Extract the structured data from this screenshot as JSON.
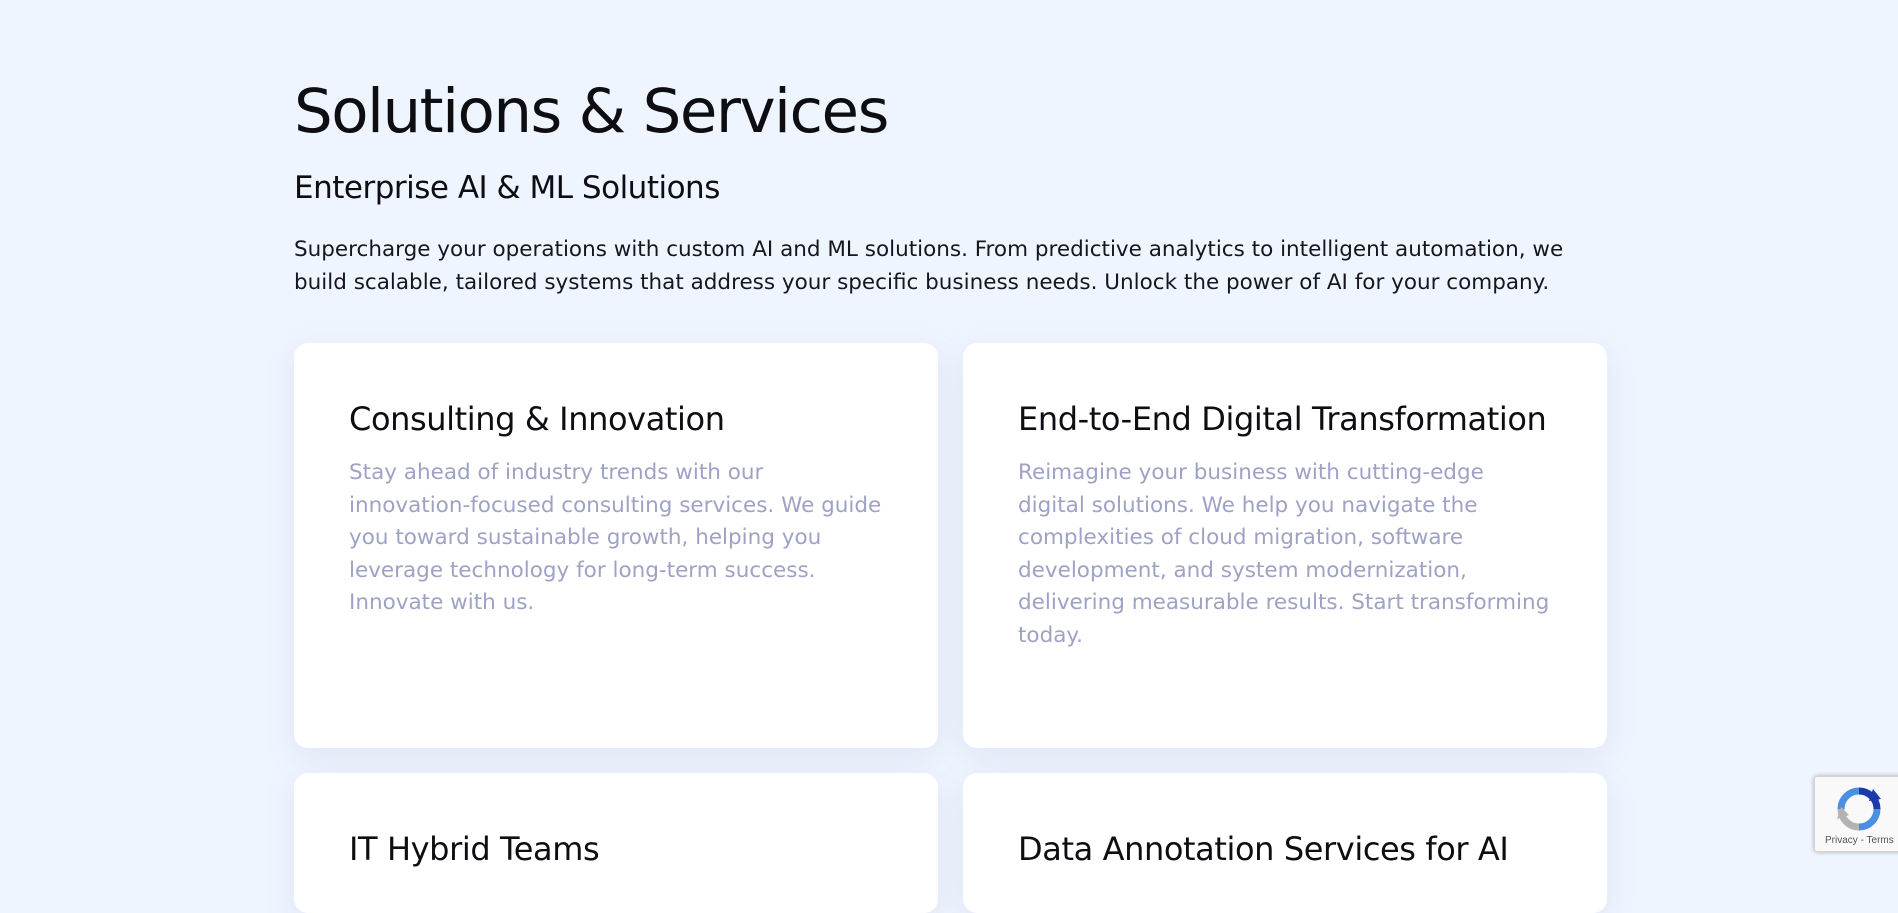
{
  "section": {
    "title": "Solutions & Services",
    "subtitle": "Enterprise AI & ML Solutions",
    "intro": "Supercharge your operations with custom AI and ML solutions. From predictive analytics to intelligent automation, we build scalable, tailored systems that address your specific business needs. Unlock the power of AI for your company."
  },
  "cards": [
    {
      "title": "Consulting & Innovation",
      "body": "Stay ahead of industry trends with our innovation-focused consulting services. We guide you toward sustainable growth, helping you leverage technology for long-term success. Innovate with us."
    },
    {
      "title": "End-to-End Digital Transformation",
      "body": "Reimagine your business with cutting-edge digital solutions. We help you navigate the complexities of cloud migration, software development, and system modernization, delivering measurable results. Start transforming today."
    },
    {
      "title": "IT Hybrid Teams",
      "body": ""
    },
    {
      "title": "Data Annotation Services for AI",
      "body": ""
    }
  ],
  "recaptcha": {
    "privacy_label": "Privacy",
    "separator": " - ",
    "terms_label": "Terms",
    "icon": "recaptcha-icon",
    "colors": {
      "blue": "#4a90e2",
      "dark_blue": "#1c3aa9",
      "grey": "#b3b3b3"
    }
  },
  "colors": {
    "background": "#eff5ff",
    "card_background": "#ffffff",
    "heading": "#0d0d12",
    "card_body_text": "#9ea2c4"
  }
}
